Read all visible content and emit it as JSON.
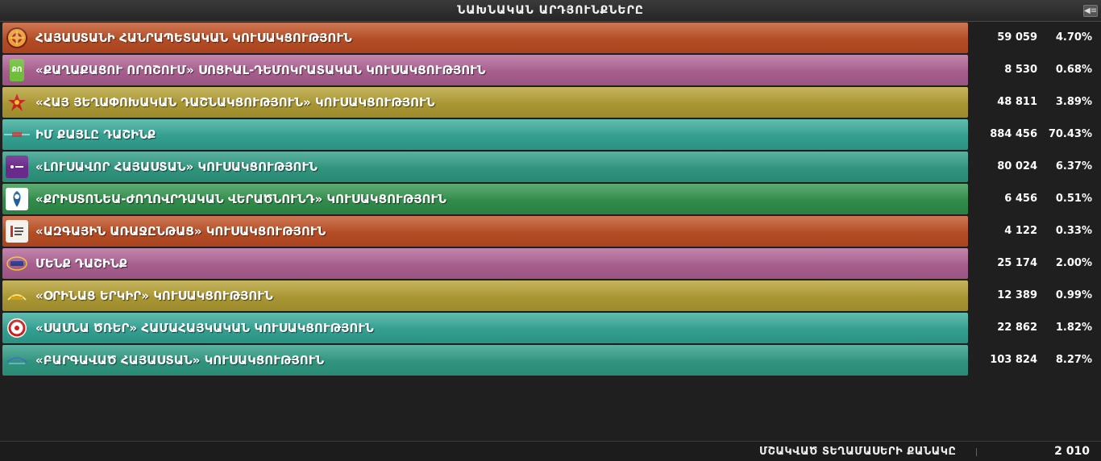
{
  "header": {
    "title": "ՆԱԽՆԱԿԱՆ ԱՐԴՅՈՒՆՔՆԵՐԸ",
    "collapse_icon": "collapse-panel-icon"
  },
  "rows": [
    {
      "name": "ՀԱՅԱՍՏԱՆԻ ՀԱՆՐԱՊԵՏԱԿԱՆ ԿՈՒՍԱԿՑՈՒԹՅՈՒՆ",
      "votes": "59 059",
      "percent": "4.70%",
      "color": "#b84f27",
      "logo": "",
      "icon": "rpa-logo-icon"
    },
    {
      "name": "«ՔԱՂԱՔԱՑՈՒ ՈՐՈՇՈՒՄ» ՍՈՑԻԱԼ-ԴԵՄՈԿՐԱՏԱԿԱՆ ԿՈՒՍԱԿՑՈՒԹՅՈՒՆ",
      "votes": "8 530",
      "percent": "0.68%",
      "color": "#a9608f",
      "logo": "ՔՈ",
      "icon": "citizens-decision-logo-icon"
    },
    {
      "name": "«ՀԱՅ ՅԵՂԱՓՈԽԱԿԱՆ ԴԱՇՆԱԿՑՈՒԹՅՈՒՆ» ԿՈՒՍԱԿՑՈՒԹՅՈՒՆ",
      "votes": "48 811",
      "percent": "3.89%",
      "color": "#ab9734",
      "logo": "",
      "icon": "arf-logo-icon"
    },
    {
      "name": "ԻՄ ՔԱՅԼԸ ԴԱՇԻՆՔ",
      "votes": "884 456",
      "percent": "70.43%",
      "color": "#37a192",
      "logo": "",
      "icon": "my-step-logo-icon"
    },
    {
      "name": "«ԼՈՒՍԱՎՈՐ ՀԱՅԱՍՏԱՆ» ԿՈՒՍԱԿՑՈՒԹՅՈՒՆ",
      "votes": "80 024",
      "percent": "6.37%",
      "color": "#33997f",
      "logo": "",
      "icon": "bright-armenia-logo-icon"
    },
    {
      "name": "«ՔՐԻՍՏՈՆԵԱ-ԺՈՂՈՎՐԴԱԿԱՆ ՎԵՐԱԾՆՈՒՆԴ» ԿՈՒՍԱԿՑՈՒԹՅՈՒՆ",
      "votes": "6 456",
      "percent": "0.51%",
      "color": "#338d4c",
      "logo": "",
      "icon": "christian-democratic-logo-icon"
    },
    {
      "name": "«ԱԶԳԱՅԻՆ ԱՌԱՋԸՆԹԱՑ» ԿՈՒՍԱԿՑՈՒԹՅՈՒՆ",
      "votes": "4 122",
      "percent": "0.33%",
      "color": "#b84f27",
      "logo": "",
      "icon": "national-progress-logo-icon"
    },
    {
      "name": "ՄԵՆՔ ԴԱՇԻՆՔ",
      "votes": "25 174",
      "percent": "2.00%",
      "color": "#a9608f",
      "logo": "",
      "icon": "we-alliance-logo-icon"
    },
    {
      "name": "«ՕՐԻՆԱՑ ԵՐԿԻՐ» ԿՈՒՍԱԿՑՈՒԹՅՈՒՆ",
      "votes": "12 389",
      "percent": "0.99%",
      "color": "#ab9734",
      "logo": "",
      "icon": "rule-of-law-logo-icon"
    },
    {
      "name": "«ՍԱՍՆԱ ԾՌԵՐ» ՀԱՄԱՀԱՅԿԱԿԱՆ ԿՈՒՍԱԿՑՈՒԹՅՈՒՆ",
      "votes": "22 862",
      "percent": "1.82%",
      "color": "#37a192",
      "logo": "",
      "icon": "sasna-tsrer-logo-icon"
    },
    {
      "name": "«ԲԱՐԳԱՎԱԾ ՀԱՅԱՍՏԱՆ» ԿՈՒՍԱԿՑՈՒԹՅՈՒՆ",
      "votes": "103 824",
      "percent": "8.27%",
      "color": "#33997f",
      "logo": "",
      "icon": "prosperous-armenia-logo-icon"
    }
  ],
  "footer": {
    "label": "ՄՇԱԿՎԱԾ ՏԵՂԱՄԱՍԵՐԻ ՔԱՆԱԿԸ",
    "count": "2 010"
  }
}
